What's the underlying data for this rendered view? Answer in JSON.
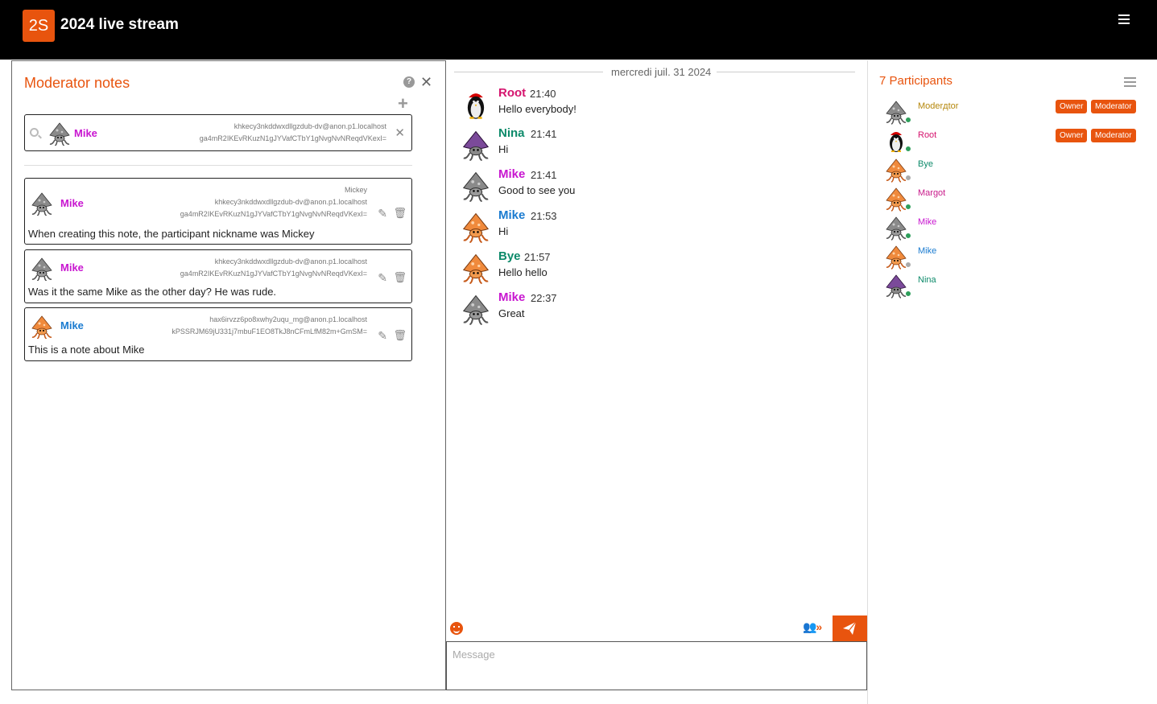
{
  "app": {
    "logo": "2S",
    "title": "2024 live stream"
  },
  "notes": {
    "title": "Moderator notes",
    "help_glyph": "?",
    "filter": {
      "name": "Mike",
      "id_line1": "khkecy3nkddwxdllgzdub-dv@anon.p1.localhost",
      "id_line2": "ga4mR2IKEvRKuzN1gJYVafCTbY1gNvgNvNReqdVKexI="
    },
    "items": [
      {
        "author": "Mike",
        "nickname": "Mickey",
        "id_line1": "khkecy3nkddwxdllgzdub-dv@anon.p1.localhost",
        "id_line2": "ga4mR2IKEvRKuzN1gJYVafCTbY1gNvgNvNReqdVKexI=",
        "text": "When creating this note, the participant nickname was Mickey"
      },
      {
        "author": "Mike",
        "id_line1": "khkecy3nkddwxdllgzdub-dv@anon.p1.localhost",
        "id_line2": "ga4mR2IKEvRKuzN1gJYVafCTbY1gNvgNvNReqdVKexI=",
        "text": "Was it the same Mike as the other day? He was rude."
      },
      {
        "author": "Mike",
        "id_line1": "hax6irvzz6po8xwhy2uqu_mg@anon.p1.localhost",
        "id_line2": "kPSSRJM69jU331j7mbuF1EO8TkJ8nCFmLfM82m+GmSM=",
        "text": "This is a note about Mike"
      }
    ]
  },
  "chat": {
    "date": "mercredi juil. 31 2024",
    "messages": [
      {
        "author": "Root",
        "time": "21:40",
        "text": "Hello everybody!",
        "color": "#d5146e"
      },
      {
        "author": "Nina",
        "time": "21:41",
        "text": "Hi",
        "color": "#0d8a6a"
      },
      {
        "author": "Mike",
        "time": "21:41",
        "text": "Good to see you",
        "color": "#c816d0"
      },
      {
        "author": "Mike",
        "time": "21:53",
        "text": "Hi",
        "color": "#1a7bd0"
      },
      {
        "author": "Bye",
        "time": "21:57",
        "text": "Hello hello",
        "color": "#0d8a6a"
      },
      {
        "author": "Mike",
        "time": "22:37",
        "text": "Great",
        "color": "#c816d0"
      }
    ],
    "message_placeholder": "Message"
  },
  "participants": {
    "title": "7 Participants",
    "badge_owner": "Owner",
    "badge_moderator": "Moderator",
    "list": [
      {
        "name": "Moderдtor",
        "color": "#b5870b",
        "online": true
      },
      {
        "name": "Root",
        "color": "#d5146e",
        "online": true
      },
      {
        "name": "Bye",
        "color": "#0d8a6a",
        "online": false
      },
      {
        "name": "Margot",
        "color": "#c81a8a",
        "online": true
      },
      {
        "name": "Mike",
        "color": "#c816d0",
        "online": true
      },
      {
        "name": "Mike",
        "color": "#1a7bd0",
        "online": false
      },
      {
        "name": "Nina",
        "color": "#0d8a6a",
        "online": true
      }
    ]
  },
  "colors": {
    "accent": "#e8540e",
    "online": "#2e9e5b",
    "offline": "#aaaaaa",
    "mike_purple": "#c816d0",
    "mike_blue": "#1a7bd0"
  }
}
